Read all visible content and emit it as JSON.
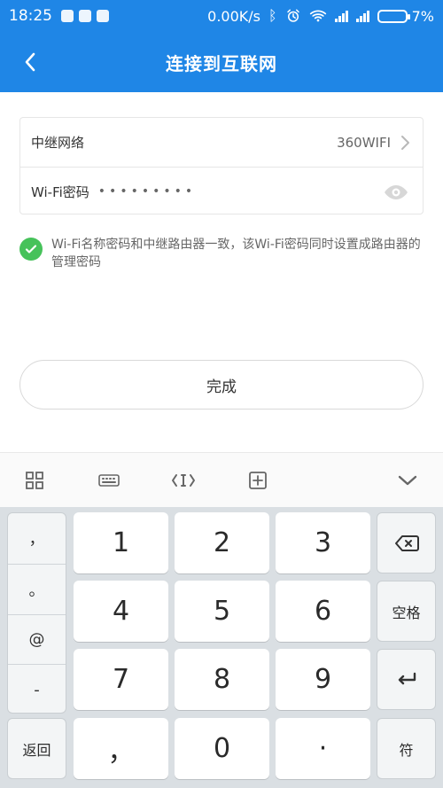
{
  "status_bar": {
    "time": "18:25",
    "network_speed": "0.00K/s",
    "battery_text": "7%",
    "battery_level": 0.07
  },
  "app_bar": {
    "title": "连接到互联网"
  },
  "form": {
    "relay_network_label": "中继网络",
    "relay_network_value": "360WIFI",
    "wifi_password_label": "Wi-Fi密码",
    "wifi_password_masked": "•••••••••"
  },
  "notice": {
    "text": "Wi-Fi名称密码和中继路由器一致，该Wi-Fi密码同时设置成路由器的管理密码"
  },
  "done_button": {
    "label": "完成"
  },
  "keyboard": {
    "left_column": [
      "，",
      "。",
      "@",
      "-"
    ],
    "bottom_left": "返回",
    "keys": {
      "k1": "1",
      "k2": "2",
      "k3": "3",
      "k4": "4",
      "k5": "5",
      "k6": "6",
      "k7": "7",
      "k8": "8",
      "k9": "9",
      "k0": "0",
      "comma": "，",
      "dot": "·",
      "space": "空格",
      "symbol": "符"
    }
  },
  "colors": {
    "brand_blue": "#1f86e6",
    "success_green": "#46c25a"
  }
}
